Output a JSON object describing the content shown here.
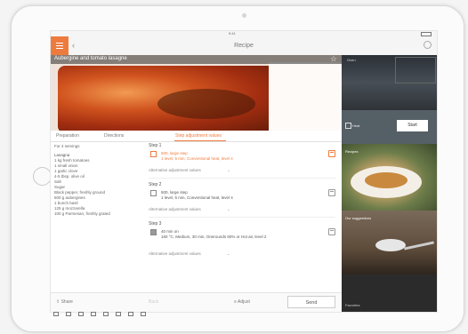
{
  "app": {
    "title": "Recipe",
    "back_label": "‹",
    "status_time": "9:41"
  },
  "hero": {
    "title": "Aubergine and tomato lasagne",
    "favorite_icon": "star-icon"
  },
  "tabs": [
    {
      "label": "Preparation",
      "active": false
    },
    {
      "label": "Directions",
      "active": false
    },
    {
      "label": "Step adjustment values",
      "active": true
    }
  ],
  "ingredients": {
    "servings": "For 4 servings",
    "items": [
      "Lasagna",
      "1 kg fresh tomatoes",
      "1 small onion",
      "1 garlic clove",
      "4-5 tbsp. olive oil",
      "Salt",
      "Sugar",
      "Black pepper, freshly ground",
      "600 g aubergines",
      "1 bunch basil",
      "125 g mozzarella",
      "100 g Parmesan, freshly grated"
    ]
  },
  "steps": [
    {
      "label": "Step 1",
      "title": "500, large step",
      "detail": "1 level, 5 min, Conventional heat, level 4",
      "adjust": "Alternative adjustment values",
      "active": true
    },
    {
      "label": "Step 2",
      "title": "500, large step",
      "detail": "1 level, 5 min, Conventional heat, level 4",
      "adjust": "Alternative adjustment values",
      "active": false
    },
    {
      "label": "Step 3",
      "title": "40 min on",
      "detail": "160 °C, Medium, 30 min, Onerounds 60% or Hot air, level 2",
      "adjust": "Alternative adjustment values",
      "active": false
    }
  ],
  "bottom": {
    "share": "Share",
    "back": "Back",
    "adjust": "Adjust",
    "send": "Send"
  },
  "right_panel": {
    "oven_label": "Oven",
    "start_label": "Start",
    "status_label": "Heat",
    "recipes_label": "Recipes",
    "suggestions_label": "Our suggestions",
    "favorites_label": "Favorites"
  },
  "colors": {
    "accent": "#ee7b3e",
    "panel_dark": "#3a3a3a"
  }
}
